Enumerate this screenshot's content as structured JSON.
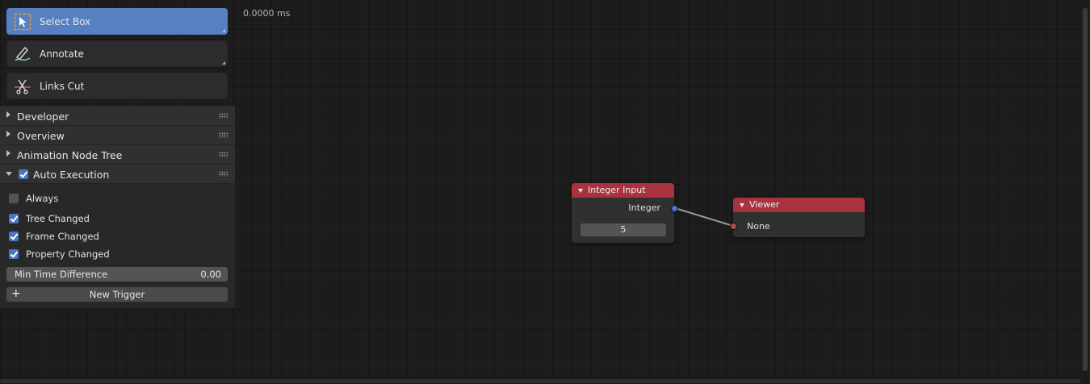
{
  "overlay": {
    "timing": "0.0000 ms"
  },
  "toolbar": {
    "select_box": "Select Box",
    "annotate": "Annotate",
    "links_cut": "Links Cut"
  },
  "panels": {
    "developer": "Developer",
    "overview": "Overview",
    "animation_node_tree": "Animation Node Tree",
    "auto_execution": "Auto Execution"
  },
  "auto_execution": {
    "always": {
      "label": "Always",
      "checked": false
    },
    "tree_changed": {
      "label": "Tree Changed",
      "checked": true
    },
    "frame_changed": {
      "label": "Frame Changed",
      "checked": true
    },
    "property_changed": {
      "label": "Property Changed",
      "checked": true
    },
    "min_time_label": "Min Time Difference",
    "min_time_value": "0.00",
    "new_trigger": "New Trigger",
    "new_trigger_icon": "+"
  },
  "nodes": {
    "integer_input": {
      "title": "Integer Input",
      "output": "Integer",
      "value": "5"
    },
    "viewer": {
      "title": "Viewer",
      "input": "None"
    }
  },
  "colors": {
    "accent": "#5680c2",
    "node_header": "#a8323e",
    "socket_integer": "#5c6bd8",
    "socket_generic": "#a05050"
  }
}
